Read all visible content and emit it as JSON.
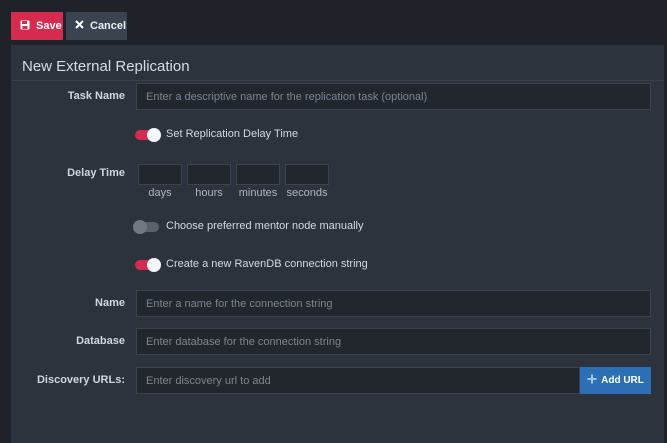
{
  "toolbar": {
    "save_label": "Save",
    "cancel_label": "Cancel"
  },
  "form": {
    "title": "New External Replication",
    "task_name": {
      "label": "Task Name",
      "placeholder": "Enter a descriptive name for the replication task (optional)"
    },
    "toggle_delay": {
      "label": "Set Replication Delay Time",
      "state": "on"
    },
    "delay_time": {
      "label": "Delay Time",
      "units": [
        "days",
        "hours",
        "minutes",
        "seconds"
      ]
    },
    "toggle_mentor": {
      "label": "Choose preferred mentor node manually",
      "state": "off"
    },
    "toggle_connection": {
      "label": "Create a new RavenDB connection string",
      "state": "on"
    },
    "name": {
      "label": "Name",
      "placeholder": "Enter a name for the connection string"
    },
    "database": {
      "label": "Database",
      "placeholder": "Enter database for the connection string"
    },
    "discovery": {
      "label": "Discovery URLs:",
      "placeholder": "Enter discovery url to add",
      "add_label": "Add URL"
    }
  },
  "colors": {
    "accent": "#d52b4e",
    "primary": "#2c6fb5",
    "panel": "#2d333c",
    "background": "#1f2329"
  },
  "icons": {
    "save": "floppy-disk-icon",
    "cancel": "x-icon",
    "add": "plus-icon"
  }
}
